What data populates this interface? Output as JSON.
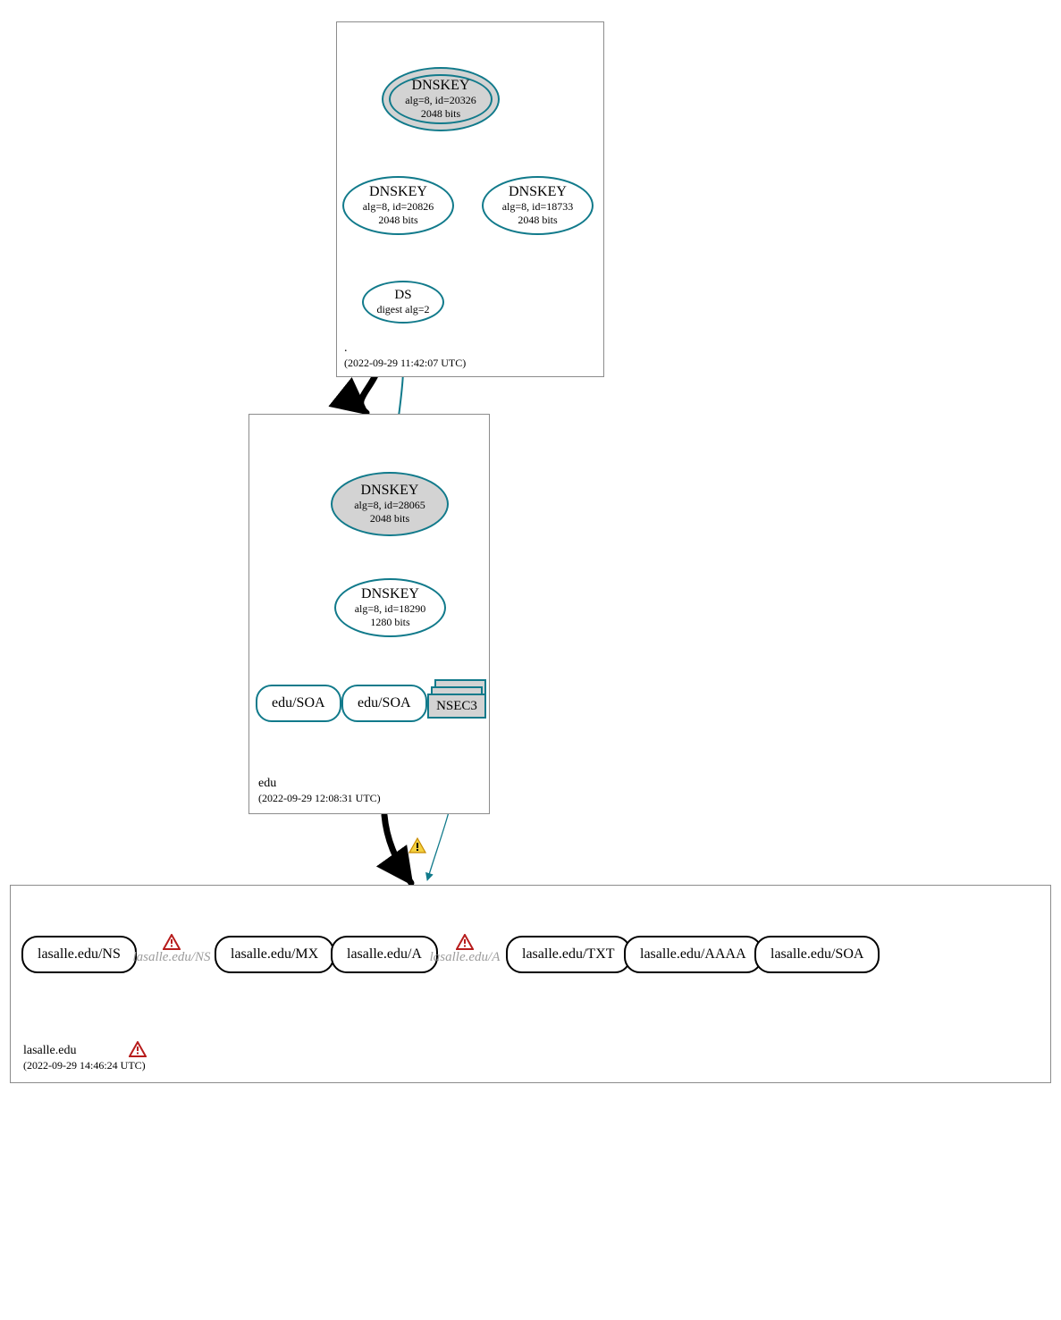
{
  "zones": {
    "root": {
      "domain": ".",
      "timestamp": "(2022-09-29 11:42:07 UTC)",
      "nodes": {
        "ksk": {
          "title": "DNSKEY",
          "alg": "alg=8, id=20326",
          "bits": "2048 bits"
        },
        "zsk1": {
          "title": "DNSKEY",
          "alg": "alg=8, id=20826",
          "bits": "2048 bits"
        },
        "zsk2": {
          "title": "DNSKEY",
          "alg": "alg=8, id=18733",
          "bits": "2048 bits"
        },
        "ds": {
          "title": "DS",
          "alg": "digest alg=2"
        }
      }
    },
    "edu": {
      "domain": "edu",
      "timestamp": "(2022-09-29 12:08:31 UTC)",
      "nodes": {
        "ksk": {
          "title": "DNSKEY",
          "alg": "alg=8, id=28065",
          "bits": "2048 bits"
        },
        "zsk": {
          "title": "DNSKEY",
          "alg": "alg=8, id=18290",
          "bits": "1280 bits"
        },
        "soa1": "edu/SOA",
        "soa2": "edu/SOA",
        "nsec3": "NSEC3"
      }
    },
    "lasalle": {
      "domain": "lasalle.edu",
      "timestamp": "(2022-09-29 14:46:24 UTC)",
      "records": {
        "ns": "lasalle.edu/NS",
        "ns_italic": "lasalle.edu/NS",
        "mx": "lasalle.edu/MX",
        "a": "lasalle.edu/A",
        "a_italic": "lasalle.edu/A",
        "txt": "lasalle.edu/TXT",
        "aaaa": "lasalle.edu/AAAA",
        "soa": "lasalle.edu/SOA"
      }
    }
  },
  "colors": {
    "teal": "#117a8b",
    "black": "#000000",
    "warn_fill": "#f4d03f",
    "warn_stroke": "#b71c1c"
  }
}
